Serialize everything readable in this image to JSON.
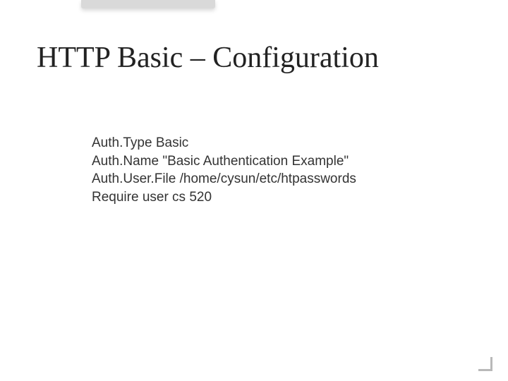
{
  "slide": {
    "title": "HTTP Basic – Configuration",
    "config_lines": [
      "Auth.Type Basic",
      "Auth.Name \"Basic Authentication Example\"",
      "Auth.User.File /home/cysun/etc/htpasswords",
      "Require user cs 520"
    ]
  }
}
